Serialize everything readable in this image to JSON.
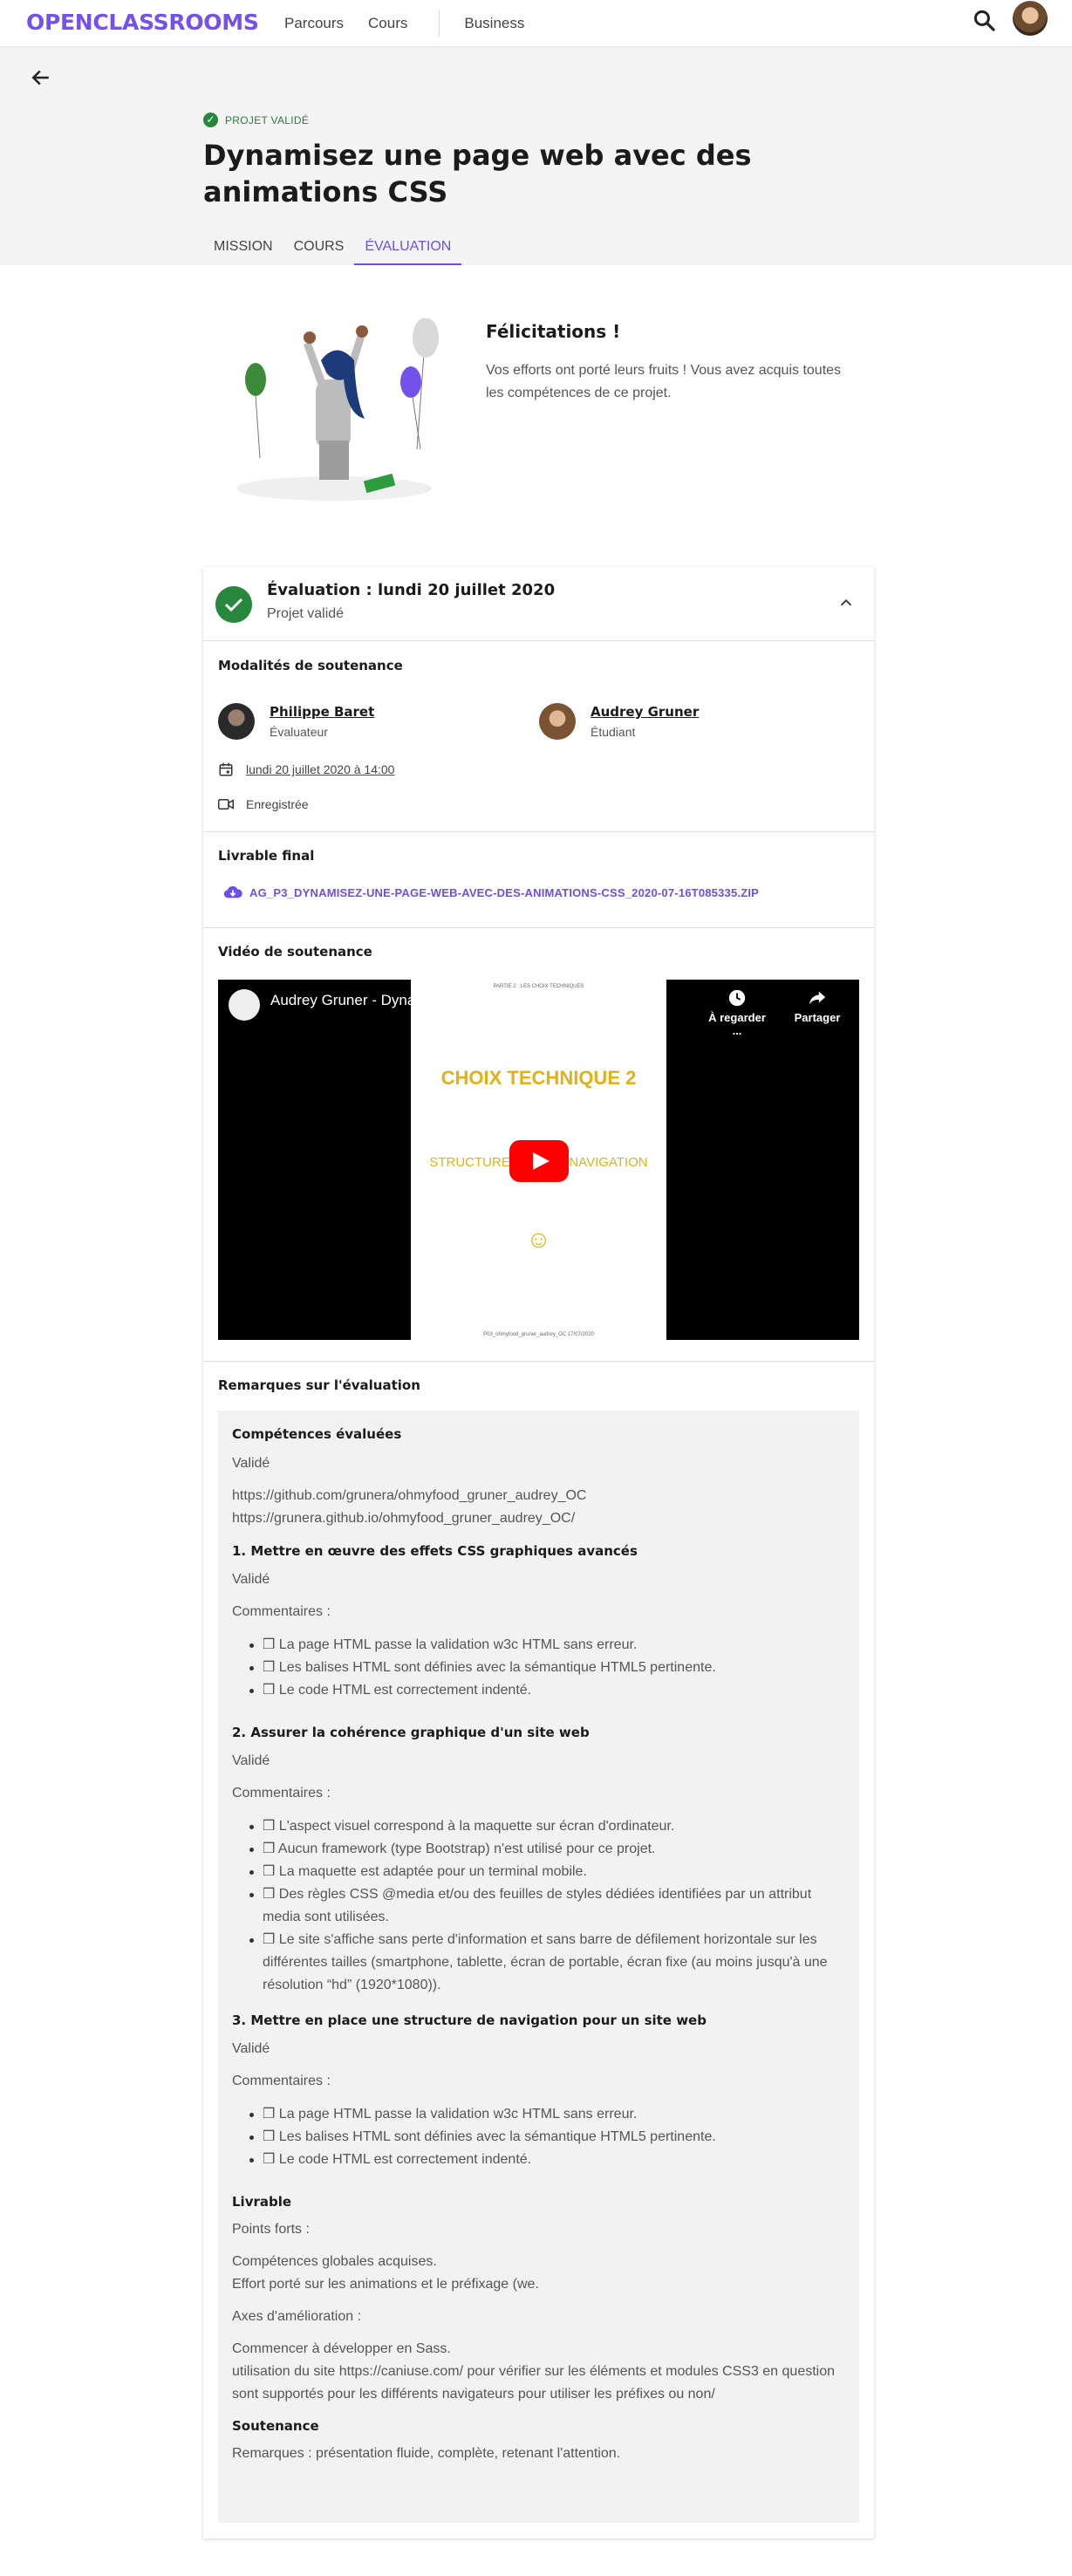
{
  "header": {
    "logo": "OPENCLASSROOMS",
    "nav": [
      "Parcours",
      "Cours",
      "Business"
    ]
  },
  "hero": {
    "status": "PROJET VALIDÉ",
    "title": "Dynamisez une page web avec des animations CSS",
    "tabs": [
      {
        "label": "MISSION",
        "active": false
      },
      {
        "label": "COURS",
        "active": false
      },
      {
        "label": "ÉVALUATION",
        "active": true
      }
    ]
  },
  "congrats": {
    "title": "Félicitations !",
    "text": "Vos efforts ont porté leurs fruits ! Vous avez acquis toutes les compétences de ce projet."
  },
  "evaluation": {
    "title": "Évaluation : lundi 20 juillet 2020",
    "subtitle": "Projet validé",
    "modalites_title": "Modalités de soutenance",
    "evaluator": {
      "name": "Philippe Baret",
      "role": "Évaluateur"
    },
    "student": {
      "name": "Audrey Gruner",
      "role": "Étudiant"
    },
    "date": "lundi 20 juillet 2020 à 14:00",
    "recorded": "Enregistrée",
    "livrable_title": "Livrable final",
    "livrable_file": "AG_P3_DYNAMISEZ-UNE-PAGE-WEB-AVEC-DES-ANIMATIONS-CSS_2020-07-16T085335.ZIP",
    "video_title": "Vidéo de soutenance",
    "video": {
      "yt_title": "Audrey Gruner - Dynamisez une page web avec des animati...",
      "watch_later": "À regarder ...",
      "share": "Partager",
      "slide_header": "PARTIE 2 : LES CHOIX TECHNIQUES",
      "slide_title": "CHOIX TECHNIQUE 2",
      "slide_sub": "STRUCTURE DU SITE NAVIGATION",
      "slide_emoji": "☺",
      "slide_footer": "P03_ohmyfood_gruner_audrey_OC   17/07/2020"
    },
    "remarks_title": "Remarques sur l'évaluation"
  },
  "remarks": {
    "competences_title": "Compétences évaluées",
    "competences_status": "Validé",
    "links": [
      "https://github.com/grunera/ohmyfood_gruner_audrey_OC",
      "https://grunera.github.io/ohmyfood_gruner_audrey_OC/"
    ],
    "sections": [
      {
        "title": "1. Mettre en œuvre des effets CSS graphiques avancés",
        "status": "Validé",
        "comments_label": "Commentaires :",
        "items": [
          "❒ La page HTML passe la validation w3c HTML sans erreur.",
          "❒ Les balises HTML sont définies avec la sémantique HTML5 pertinente.",
          "❒ Le code HTML est correctement indenté."
        ]
      },
      {
        "title": "2. Assurer la cohérence graphique d'un site web",
        "status": "Validé",
        "comments_label": "Commentaires :",
        "items": [
          "❒ L'aspect visuel correspond à la maquette sur écran d'ordinateur.",
          "❒ Aucun framework (type Bootstrap) n'est utilisé pour ce projet.",
          "❒ La maquette est adaptée pour un terminal mobile.",
          "❒ Des règles CSS @media et/ou des feuilles de styles dédiées identifiées par un attribut media sont utilisées.",
          "❒ Le site s'affiche sans perte d'information et sans barre de défilement horizontale sur les différentes tailles (smartphone, tablette, écran de portable, écran fixe (au moins jusqu'à une résolution “hd” (1920*1080))."
        ]
      },
      {
        "title": "3. Mettre en place une structure de navigation pour un site web",
        "status": "Validé",
        "comments_label": "Commentaires :",
        "items": [
          "❒ La page HTML passe la validation w3c HTML sans erreur.",
          "❒ Les balises HTML sont définies avec la sémantique HTML5 pertinente.",
          "❒ Le code HTML est correctement indenté."
        ]
      }
    ],
    "livrable": {
      "title": "Livrable",
      "strengths_label": "Points forts :",
      "strengths": [
        "Compétences globales acquises.",
        "Effort porté sur les animations et le préfixage (we."
      ],
      "improve_label": "Axes d'amélioration :",
      "improve": [
        "Commencer à développer en Sass.",
        "utilisation du site https://caniuse.com/ pour vérifier sur les éléments et modules CSS3 en question sont supportés pour les différents navigateurs pour utiliser les préfixes ou non/"
      ]
    },
    "soutenance": {
      "title": "Soutenance",
      "text": "Remarques : présentation fluide, complète, retenant l'attention."
    }
  },
  "colors": {
    "brand": "#7451eb",
    "accent": "#6e4ee8",
    "success": "#27873d"
  },
  "icons": [
    "search-icon",
    "back-arrow-icon",
    "check-icon",
    "chevron-up-icon",
    "calendar-icon",
    "video-camera-icon",
    "cloud-download-icon",
    "clock-icon",
    "share-icon",
    "play-icon"
  ]
}
